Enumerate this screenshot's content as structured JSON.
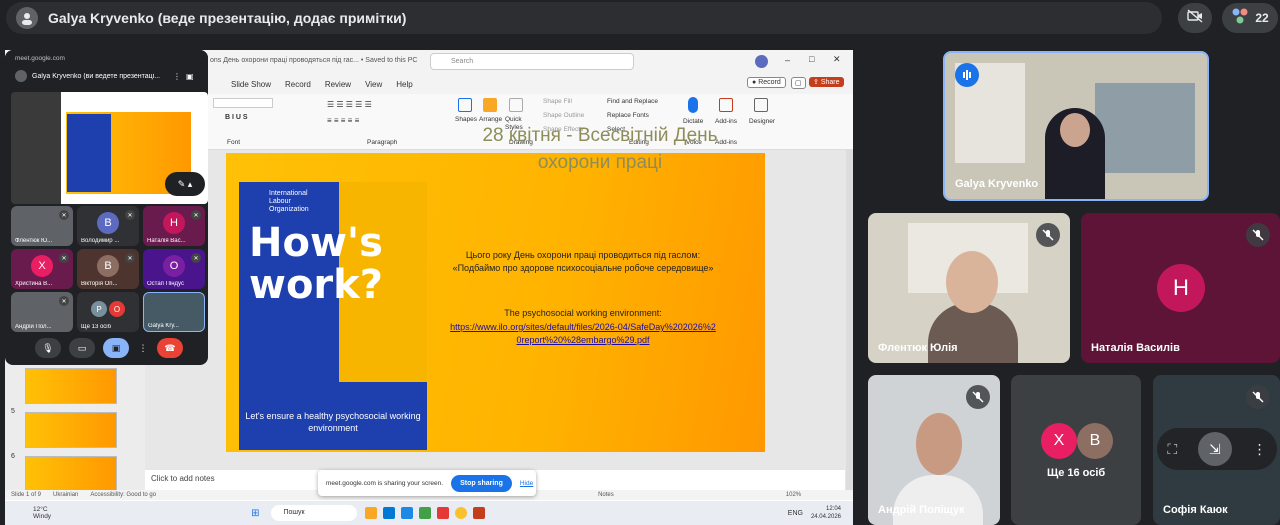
{
  "header": {
    "presenter_title": "Galya Kryvenko (веде презентацію, додає примітки)",
    "participant_count": "22"
  },
  "ppt": {
    "titlebar_text": "ons День охорони праці проводяться під гас... • Saved to this PC",
    "search_placeholder": "Search",
    "menu": [
      "Slide Show",
      "Record",
      "Review",
      "View",
      "Help"
    ],
    "record_label": "Record",
    "share_label": "Share",
    "ribbon": {
      "font": "Font",
      "paragraph": "Paragraph",
      "drawing": "Drawing",
      "editing": "Editing",
      "voice": "Voice",
      "addins": "Add-ins",
      "shapes": "Shapes",
      "arrange": "Arrange",
      "quick_styles": "Quick Styles",
      "shape_fill": "Shape Fill",
      "shape_outline": "Shape Outline",
      "shape_effects": "Shape Effects",
      "find_replace": "Find and Replace",
      "replace_fonts": "Replace Fonts",
      "select": "Select",
      "dictate": "Dictate",
      "addins_btn": "Add-ins",
      "designer": "Designer"
    },
    "slide": {
      "poster_big": "How's work?",
      "poster_org": "International Labour Organization",
      "poster_bottom": "Let's ensure a healthy psychosocial working environment",
      "title": "28 квітня - Всесвітній День охорони праці",
      "body": "Цього року День охорони праці проводиться під гаслом: «Подбаймо про здорове психосоціальне робоче середовище»",
      "sub": "The psychosocial working environment:",
      "link": "https://www.ilo.org/sites/default/files/2026-04/SafeDay%202026%20report%20%28embargo%29.pdf"
    },
    "thumb_numbers": [
      "5",
      "6"
    ],
    "notes_placeholder": "Click to add notes",
    "status": {
      "slide": "Slide 1 of 9",
      "language": "Ukrainian",
      "accessibility": "Accessibility: Good to go",
      "notes": "Notes",
      "zoom": "102%"
    },
    "sharing": {
      "text": "meet.google.com is sharing your screen.",
      "stop": "Stop sharing",
      "hide": "Hide"
    },
    "taskbar": {
      "weather_temp": "12°C",
      "weather_desc": "Windy",
      "search": "Пошук",
      "lang": "ENG",
      "time": "12:04",
      "date": "24.04.2026"
    }
  },
  "pip": {
    "url": "meet.google.com",
    "presenter": "Galya Kryvenko (ви ведете презентаці...",
    "tiles": [
      {
        "label": "Флентюк Ю...",
        "initial": "",
        "color": "#5f6368"
      },
      {
        "label": "Володимир ...",
        "initial": "В",
        "color": "#5c6bc0"
      },
      {
        "label": "Наталія Вас...",
        "initial": "Н",
        "color": "#c2185b"
      },
      {
        "label": "Христина В...",
        "initial": "Х",
        "color": "#e91e63"
      },
      {
        "label": "Вікторія Оп...",
        "initial": "В",
        "color": "#8d6e63"
      },
      {
        "label": "Остап Піндус",
        "initial": "О",
        "color": "#7b1fa2"
      },
      {
        "label": "Андрій Пол...",
        "initial": "",
        "color": "#5f6368"
      },
      {
        "label": "Ще 13 осіб",
        "initial": "Р",
        "color": "#78909c"
      },
      {
        "label": "Galya Kry...",
        "initial": "",
        "color": "#455a64"
      }
    ]
  },
  "right": {
    "tiles": [
      {
        "name": "Galya Kryvenko"
      },
      {
        "name": "Флентюк Юлія"
      },
      {
        "name": "Наталія Василів",
        "initial": "Н",
        "color": "#c2185b"
      },
      {
        "name": "Андрій Поліщук"
      },
      {
        "name": "Ще 16 осіб",
        "initials": [
          "Х",
          "В"
        ],
        "colors": [
          "#e91e63",
          "#8d6e63"
        ]
      },
      {
        "name": "Софія Каюк"
      }
    ]
  }
}
